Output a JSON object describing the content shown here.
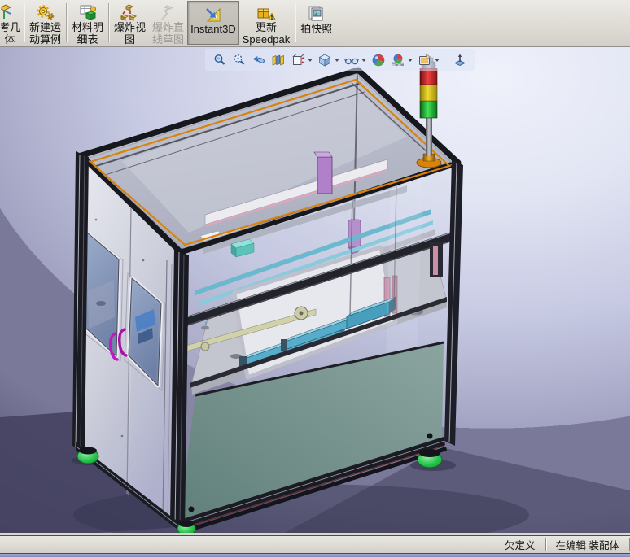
{
  "toolbar": {
    "buttons": [
      {
        "id": "reference-geometry",
        "lines": [
          "考几",
          "体"
        ],
        "partial": true,
        "has_dropdown": true
      },
      {
        "id": "new-motion-study",
        "lines": [
          "新建运",
          "动算例"
        ]
      },
      {
        "id": "bill-of-materials",
        "lines": [
          "材料明",
          "细表"
        ]
      },
      {
        "id": "exploded-view",
        "lines": [
          "爆炸视",
          "图"
        ]
      },
      {
        "id": "explode-line-sketch",
        "lines": [
          "爆炸直",
          "线草图"
        ],
        "disabled": true
      },
      {
        "id": "instant3d",
        "lines": [
          "Instant3D"
        ],
        "pressed": true
      },
      {
        "id": "update-speedpak",
        "lines": [
          "更新",
          "Speedpak"
        ]
      },
      {
        "id": "take-snapshot",
        "lines": [
          "拍快照"
        ]
      }
    ]
  },
  "headsup_toolbar": {
    "items": [
      {
        "icon": "zoom-to-fit-icon"
      },
      {
        "icon": "zoom-to-area-icon"
      },
      {
        "icon": "previous-view-icon"
      },
      {
        "icon": "section-view-icon"
      },
      {
        "icon": "view-orientation-icon",
        "dropdown": true
      },
      {
        "icon": "display-style-icon",
        "dropdown": true
      },
      {
        "icon": "hide-show-items-icon",
        "dropdown": true
      },
      {
        "icon": "edit-appearance-icon"
      },
      {
        "icon": "apply-scene-icon",
        "dropdown": true
      },
      {
        "icon": "view-settings-icon",
        "dropdown": true
      },
      {
        "icon": "normal-to-icon"
      }
    ]
  },
  "statusbar": {
    "constraint_status": "欠定义",
    "edit_status": "在编辑 装配体"
  },
  "scene": {
    "model": "machine-enclosure-assembly",
    "colors": {
      "frame_extrusion": "#1b1b23",
      "orange_trim": "#d8830c",
      "glass": "#b9bcc9",
      "door_panel": "#e6e7ee",
      "door_handle_magenta": "#c218c2",
      "lower_panel_teal": "#7d9894",
      "interior_rail_cyan": "#3fa9c9",
      "actuator_purple": "#b080c8",
      "leveling_foot_green": "#1fae3c",
      "tower_red": "#e03030",
      "tower_yellow": "#f0dc30",
      "tower_green": "#42e455",
      "background_top": "#eff1fb",
      "background_bottom": "#403e5a"
    }
  }
}
